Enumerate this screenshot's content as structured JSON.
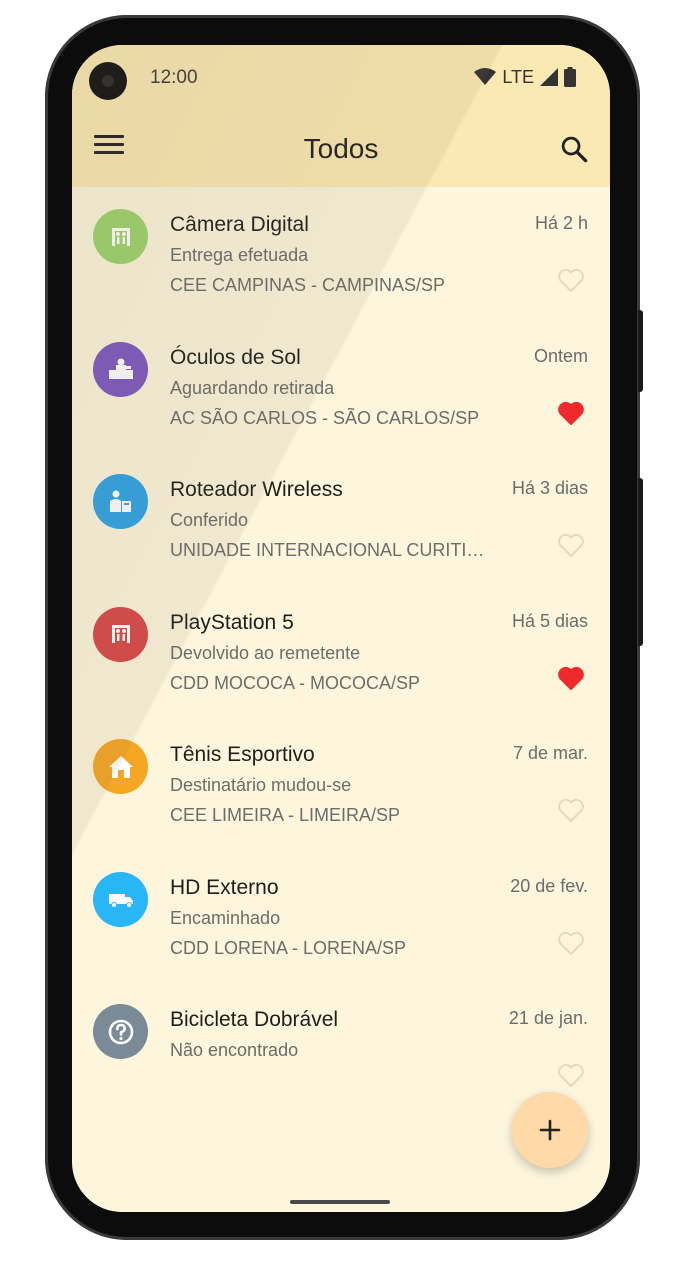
{
  "status_bar": {
    "time": "12:00",
    "network": "LTE"
  },
  "app_bar": {
    "title": "Todos"
  },
  "accent": {
    "fav_color": "#ef2a2a",
    "heart_outline": "#e3d9c0",
    "fab_color": "#ffd9a8"
  },
  "items": [
    {
      "name": "Câmera Digital",
      "status": "Entrega efetuada",
      "location": "CEE CAMPINAS - CAMPINAS/SP",
      "date": "Há 2 h",
      "icon": "handover-icon",
      "color": "#9ed36c",
      "favorite": false
    },
    {
      "name": "Óculos de Sol",
      "status": "Aguardando retirada",
      "location": "AC SÃO CARLOS - SÃO CARLOS/SP",
      "date": "Ontem",
      "icon": "counter-icon",
      "color": "#7e57c2",
      "favorite": true
    },
    {
      "name": "Roteador Wireless",
      "status": "Conferido",
      "location": "UNIDADE INTERNACIONAL CURITIBA/PR",
      "date": "Há 3 dias",
      "icon": "inspector-icon",
      "color": "#2ea4e4",
      "favorite": false
    },
    {
      "name": "PlayStation 5",
      "status": "Devolvido ao remetente",
      "location": "CDD MOCOCA - MOCOCA/SP",
      "date": "Há 5 dias",
      "icon": "handover-icon",
      "color": "#d94848",
      "favorite": true
    },
    {
      "name": "Tênis Esportivo",
      "status": "Destinatário mudou-se",
      "location": "CEE LIMEIRA - LIMEIRA/SP",
      "date": "7 de mar.",
      "icon": "house-icon",
      "color": "#f5a623",
      "favorite": false
    },
    {
      "name": "HD Externo",
      "status": "Encaminhado",
      "location": "CDD LORENA - LORENA/SP",
      "date": "20 de fev.",
      "icon": "truck-icon",
      "color": "#29b6f6",
      "favorite": false
    },
    {
      "name": "Bicicleta Dobrável",
      "status": "Não encontrado",
      "location": "",
      "date": "21 de jan.",
      "icon": "question-icon",
      "color": "#7a8a96",
      "favorite": false
    }
  ],
  "fab": {
    "label": "+"
  }
}
